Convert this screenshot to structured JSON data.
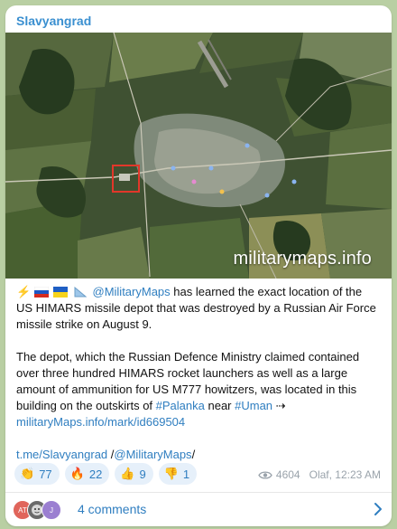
{
  "post": {
    "channel_name": "Slavyangrad",
    "watermark": "militarymaps.info",
    "paragraph1": {
      "mention": "@MilitaryMaps",
      "text": " has learned the exact location of the US HIMARS missile depot that was destroyed by a Russian Air Force missile strike on August 9."
    },
    "paragraph2": {
      "text_before": "The depot, which the Russian Defence Ministry claimed contained over three hundred HIMARS rocket launchers as well as a large amount of ammunition for US M777 howitzers, was located in this building on the outskirts of ",
      "hashtag1": "#Palanka",
      "text_mid": " near ",
      "hashtag2": "#Uman",
      "arrow": " ⇢ ",
      "link": "militaryMaps.info/mark/id669504"
    },
    "paragraph3": {
      "link1": "t.me/Slavyangrad",
      "separator": " /",
      "link2": "@MilitaryMaps",
      "trailing": "/"
    }
  },
  "reactions": [
    {
      "emoji": "👏",
      "count": "77"
    },
    {
      "emoji": "🔥",
      "count": "22"
    },
    {
      "emoji": "👍",
      "count": "9"
    },
    {
      "emoji": "👎",
      "count": "1"
    }
  ],
  "meta": {
    "views": "4604",
    "author_time": "Olaf, 12:23 AM",
    "icon": "eye-icon"
  },
  "comments": {
    "label": "4 comments",
    "avatars": [
      {
        "initials": "AT",
        "color": "#e0655b"
      },
      {
        "initials": "",
        "color": "#6b6b6b"
      },
      {
        "initials": "J",
        "color": "#9b7fd1"
      }
    ]
  },
  "colors": {
    "accent": "#2f7ec0",
    "channel": "#3a8fd0",
    "background": "#b9cfa3"
  }
}
